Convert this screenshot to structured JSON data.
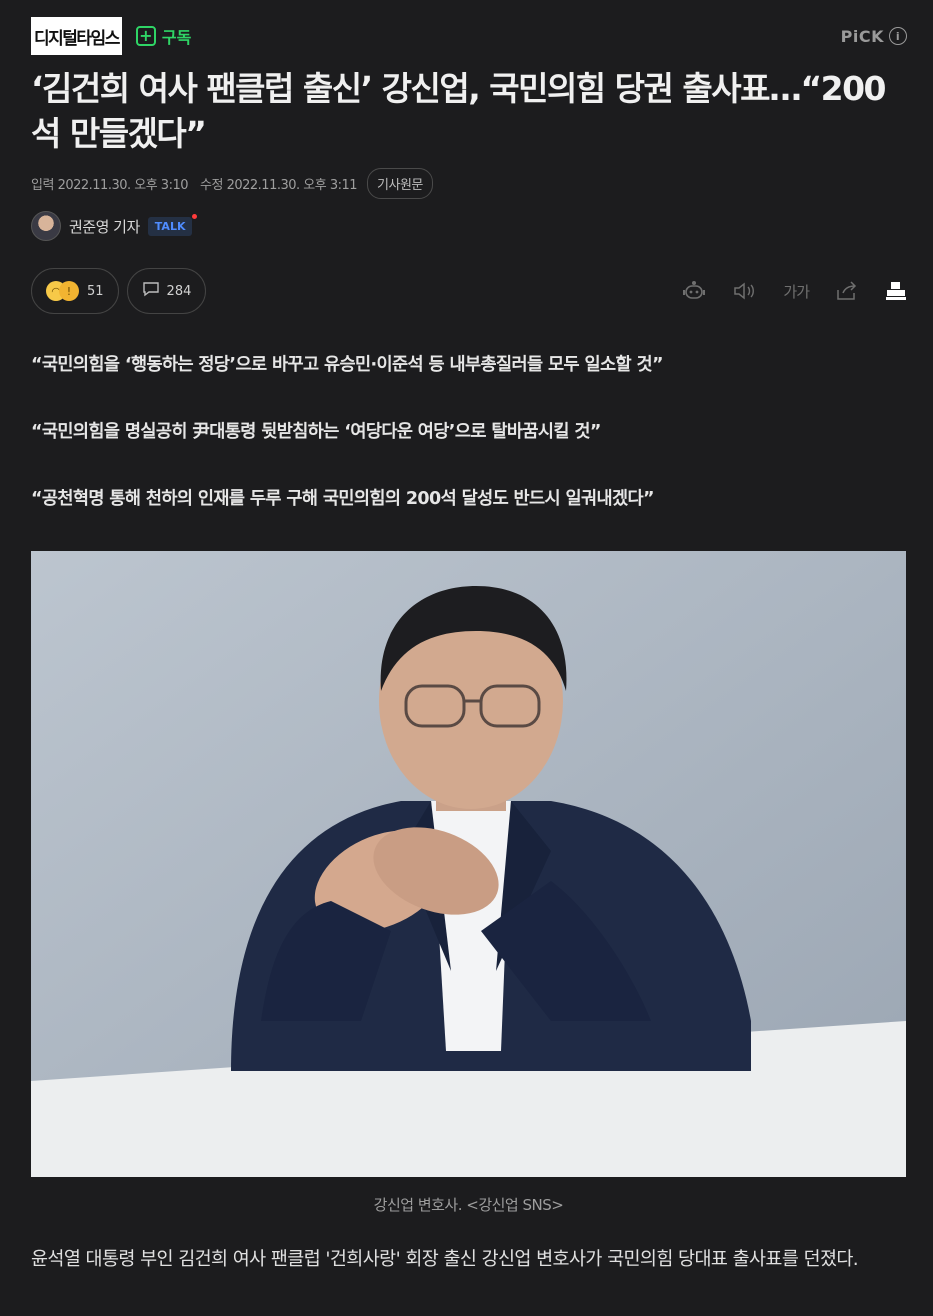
{
  "press": {
    "name": "디지털타임스",
    "subscribe_label": "구독",
    "pick_label": "PiCK",
    "pick_info": "i"
  },
  "article": {
    "title": "‘김건희 여사 팬클럽 출신’ 강신업, 국민의힘 당권 출사표…“200석 만들겠다”",
    "input_label": "입력",
    "input_date": "2022.11.30. 오후 3:10",
    "modified_label": "수정",
    "modified_date": "2022.11.30. 오후 3:11",
    "original_button": "기사원문",
    "reporter": "권준영 기자",
    "talk_badge": "TALK"
  },
  "actions": {
    "reaction_count": "51",
    "comment_count": "284",
    "tools": [
      "robot-summary-icon",
      "speaker-icon",
      "font-size-icon",
      "share-icon",
      "print-icon"
    ],
    "font_size_label": "가가"
  },
  "summary": [
    "“국민의힘을 ‘행동하는 정당’으로 바꾸고 유승민·이준석 등 내부총질러들 모두 일소할 것”",
    "“국민의힘을 명실공히 尹대통령 뒷받침하는 ‘여당다운 여당’으로 탈바꿈시킬 것”",
    "“공천혁명 통해 천하의 인재를 두루 구해 국민의힘의 200석 달성도 반드시 일궈내겠다”"
  ],
  "photo": {
    "caption": "강신업 변호사. <강신업 SNS>"
  },
  "body": {
    "paragraph_1": "윤석열 대통령 부인 김건희 여사 팬클럽 '건희사랑' 회장 출신 강신업 변호사가 국민의힘 당대표 출사표를 던졌다."
  },
  "colors": {
    "background": "#1c1c1e",
    "accent_green": "#2fd566",
    "talk_blue": "#4f8cff"
  }
}
